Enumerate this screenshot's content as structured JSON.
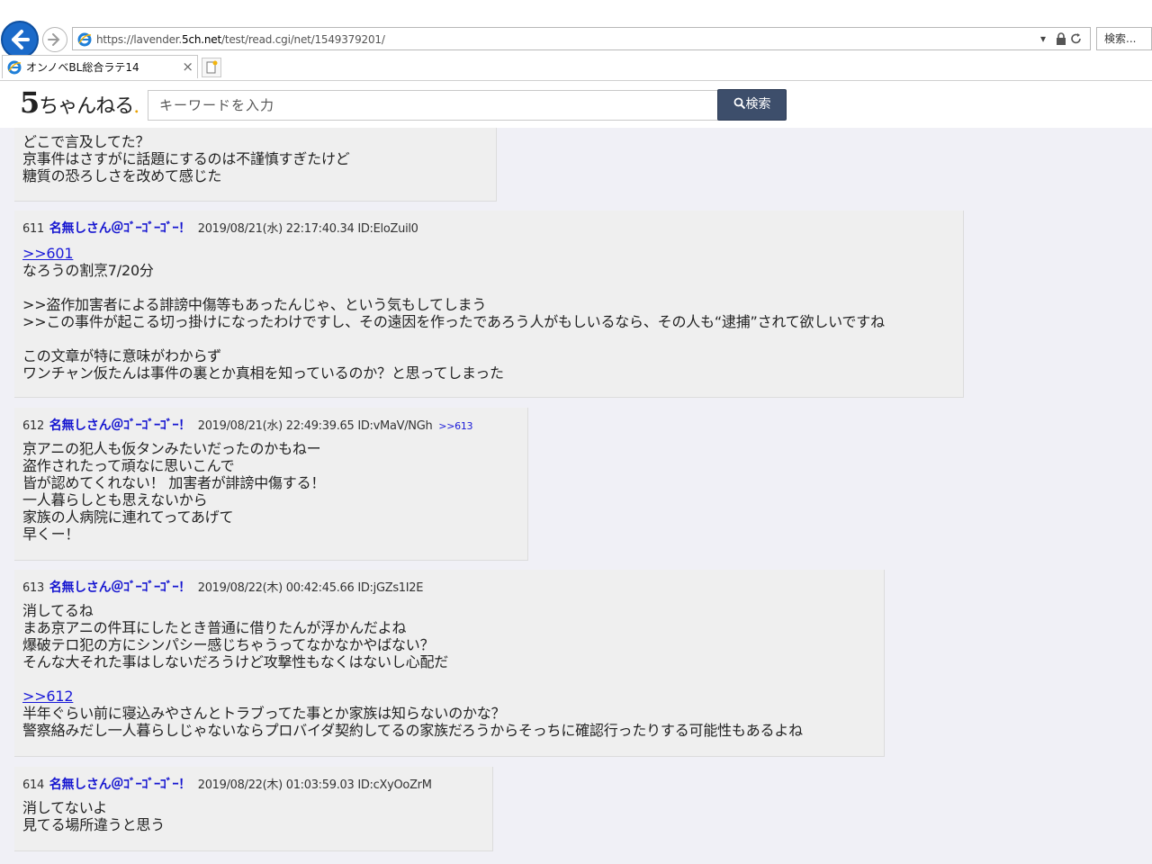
{
  "browser": {
    "url_prefix": "https://lavender.",
    "url_domain": "5ch.net",
    "url_path": "/test/read.cgi/net/1549379201/",
    "search_placeholder": "検索...",
    "tab_title": "オンノベBL総合ラテ14",
    "tab_close": "×"
  },
  "site": {
    "logo_five": "5",
    "logo_rest": "ちゃんねる",
    "logo_dot": ".",
    "search_placeholder": "キーワードを入力",
    "search_button": "検索"
  },
  "top_fragment": {
    "lines": "どこで言及してた？\n京事件はさすがに話題にするのは不謹慎すぎたけど\n糖質の恐ろしさを改めて感じた"
  },
  "posts": [
    {
      "num": "611",
      "name": "名無しさん＠ｺﾞｰｺﾞｰｺﾞｰ！",
      "meta": "2019/08/21(水) 22:17:40.34 ID:EloZuil0",
      "reply_ref": "",
      "anchor": ">>601",
      "body": "なろうの割烹7/20分\n\n>>盗作加害者による誹謗中傷等もあったんじゃ、という気もしてしまう\n>>この事件が起こる切っ掛けになったわけですし、その遠因を作ったであろう人がもしいるなら、その人も“逮捕”されて欲しいですね\n\nこの文章が特に意味がわからず\nワンチャン仮たんは事件の裏とか真相を知っているのか？と思ってしまった"
    },
    {
      "num": "612",
      "name": "名無しさん＠ｺﾞｰｺﾞｰｺﾞｰ！",
      "meta": "2019/08/21(水) 22:49:39.65 ID:vMaV/NGh",
      "reply_ref": ">>613",
      "anchor": "",
      "body": "京アニの犯人も仮タンみたいだったのかもねー\n盗作されたって頑なに思いこんで\n皆が認めてくれない！ 加害者が誹謗中傷する！\n一人暮らしとも思えないから\n家族の人病院に連れてってあげて\n早くー！"
    },
    {
      "num": "613",
      "name": "名無しさん＠ｺﾞｰｺﾞｰｺﾞｰ！",
      "meta": "2019/08/22(木) 00:42:45.66 ID:jGZs1I2E",
      "reply_ref": "",
      "body_top": "消してるね\nまあ京アニの件耳にしたとき普通に借りたんが浮かんだよね\n爆破テロ犯の方にシンパシー感じちゃうってなかなかやばない？\nそんな大それた事はしないだろうけど攻撃性もなくはないし心配だ",
      "anchor": ">>612",
      "body": "半年ぐらい前に寝込みやさんとトラブってた事とか家族は知らないのかな？\n警察絡みだし一人暮らしじゃないならプロバイダ契約してるの家族だろうからそっちに確認行ったりする可能性もあるよね"
    },
    {
      "num": "614",
      "name": "名無しさん＠ｺﾞｰｺﾞｰｺﾞｰ！",
      "meta": "2019/08/22(木) 01:03:59.03 ID:cXyOoZrM",
      "reply_ref": "",
      "anchor": "",
      "body": "消してないよ\n見てる場所違うと思う"
    }
  ],
  "colors": {
    "back_button": "#1b6ac9",
    "search_button": "#3d4e6b",
    "name": "#1515d0",
    "post_bg": "#efefef",
    "page_bg": "#f0f0f6"
  }
}
